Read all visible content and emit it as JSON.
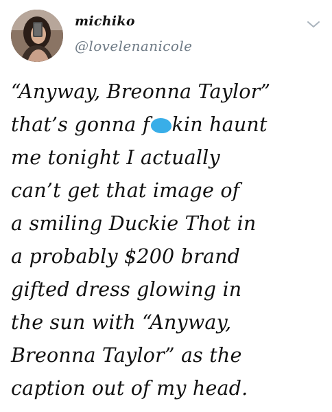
{
  "tweet": {
    "display_name": "michiko",
    "handle": "@lovelenanicole",
    "text": {
      "line_1": "“Anyway, Breonna Taylor”",
      "line_2_before": "that’s gonna f",
      "line_2_after": "kin haunt",
      "line_3": "me tonight I actually",
      "line_4": "can’t get that image of",
      "line_5": "a smiling Duckie Thot in",
      "line_6": "a probably $200 brand",
      "line_7": "gifted dress glowing in",
      "line_8": "the sun with “Anyway,",
      "line_9": "Breonna Taylor” as the",
      "line_10": "caption out of my head."
    }
  },
  "icons": {
    "avatar": "profile-photo",
    "menu": "chevron-down-icon",
    "censor": "blue-scribble-censor"
  },
  "colors": {
    "handle": "#6f7b86",
    "text": "#111111",
    "censor": "#39aee8",
    "chevron": "#a9b3bc"
  }
}
